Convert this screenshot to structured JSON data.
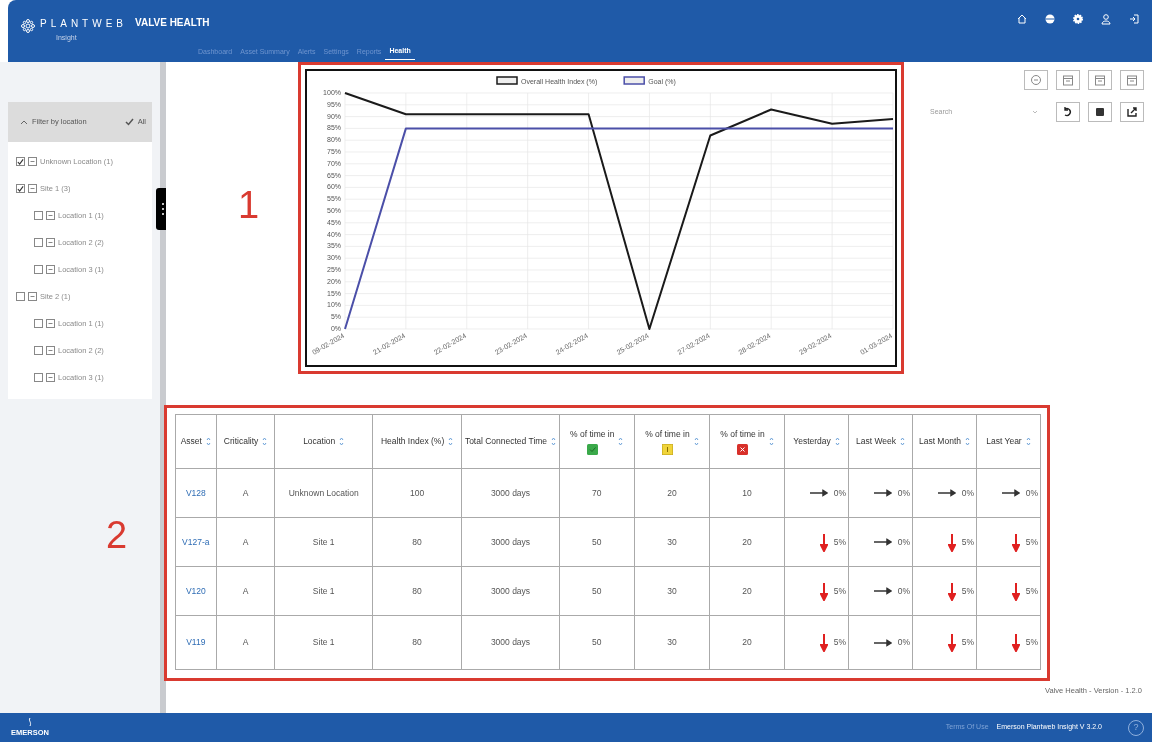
{
  "header": {
    "brand": "PLANTWEB",
    "brand_sub": "Insight",
    "app_title": "VALVE HEALTH"
  },
  "tabs": [
    {
      "label": "Dashboard",
      "selected": false
    },
    {
      "label": "Asset Summary",
      "selected": false
    },
    {
      "label": "Alerts",
      "selected": false
    },
    {
      "label": "Settings",
      "selected": false
    },
    {
      "label": "Reports",
      "selected": false
    },
    {
      "label": "Health",
      "selected": true
    }
  ],
  "filter": {
    "title": "Filter by location",
    "all_label": "All",
    "all_checked": true,
    "tree": [
      {
        "label": "Unknown Location (1)",
        "checked": true
      },
      {
        "label": "Site  1 (3)",
        "checked": true,
        "children": [
          {
            "label": "Location 1 (1)",
            "checked": false
          },
          {
            "label": "Location 2 (2)",
            "checked": false
          },
          {
            "label": "Location 3 (1)",
            "checked": false
          }
        ]
      },
      {
        "label": "Site 2 (1)",
        "checked": false,
        "children": [
          {
            "label": "Location 1 (1)",
            "checked": false
          },
          {
            "label": "Location 2 (2)",
            "checked": false
          },
          {
            "label": "Location 3 (1)",
            "checked": false
          }
        ]
      }
    ]
  },
  "annotations": [
    "1",
    "2"
  ],
  "chart": {
    "chart_data": {
      "type": "line",
      "categories": [
        "09-02-2024",
        "21-02-2024",
        "22-02-2024",
        "23-02-2024",
        "24-02-2024",
        "25-02-2024",
        "27-02-2024",
        "28-02-2024",
        "29-02-2024",
        "01-03-2024"
      ],
      "series": [
        {
          "name": "Overall Health Index (%)",
          "color": "#1a1a1a",
          "values": [
            100,
            91,
            91,
            91,
            91,
            0,
            82,
            93,
            87,
            89
          ]
        },
        {
          "name": "Goal (%)",
          "color": "#4b4fa8",
          "values": [
            0,
            85,
            85,
            85,
            85,
            85,
            85,
            85,
            85,
            85
          ]
        }
      ],
      "grid": true,
      "legend": true,
      "ylim": [
        0,
        100
      ],
      "yticks": [
        {
          "value": 0,
          "label": "0%"
        },
        {
          "value": 5,
          "label": "5%"
        },
        {
          "value": 10,
          "label": "10%"
        },
        {
          "value": 15,
          "label": "15%"
        },
        {
          "value": 20,
          "label": "20%"
        },
        {
          "value": 25,
          "label": "25%"
        },
        {
          "value": 30,
          "label": "30%"
        },
        {
          "value": 35,
          "label": "35%"
        },
        {
          "value": 40,
          "label": "40%"
        },
        {
          "value": 45,
          "label": "45%"
        },
        {
          "value": 50,
          "label": "50%"
        },
        {
          "value": 55,
          "label": "55%"
        },
        {
          "value": 60,
          "label": "60%"
        },
        {
          "value": 65,
          "label": "65%"
        },
        {
          "value": 70,
          "label": "70%"
        },
        {
          "value": 75,
          "label": "75%"
        },
        {
          "value": 80,
          "label": "80%"
        },
        {
          "value": 85,
          "label": "85%"
        },
        {
          "value": 90,
          "label": "90%"
        },
        {
          "value": 95,
          "label": "95%"
        },
        {
          "value": 100,
          "label": "100%"
        }
      ]
    }
  },
  "search": {
    "placeholder": "Search"
  },
  "table": {
    "columns": [
      {
        "label": "Asset"
      },
      {
        "label": "Criticality"
      },
      {
        "label": "Location"
      },
      {
        "label": "Health Index (%)"
      },
      {
        "label": "Total Connected Time"
      },
      {
        "label": "% of time in",
        "kind": "good"
      },
      {
        "label": "% of time in",
        "kind": "warn"
      },
      {
        "label": "% of time in",
        "kind": "bad"
      },
      {
        "label": "Yesterday"
      },
      {
        "label": "Last Week"
      },
      {
        "label": "Last Month"
      },
      {
        "label": "Last Year"
      }
    ],
    "rows": [
      {
        "asset": "V128",
        "criticality": "A",
        "location": "Unknown Location",
        "health": "100",
        "time": "3000 days",
        "good": "70",
        "warn": "20",
        "bad": "10",
        "trends": [
          {
            "kind": "flat",
            "text": "0%"
          },
          {
            "kind": "flat",
            "text": "0%"
          },
          {
            "kind": "flat",
            "text": "0%"
          },
          {
            "kind": "flat",
            "text": "0%"
          }
        ]
      },
      {
        "asset": "V127-a",
        "criticality": "A",
        "location": "Site 1",
        "health": "80",
        "time": "3000 days",
        "good": "50",
        "warn": "30",
        "bad": "20",
        "trends": [
          {
            "kind": "down",
            "text": "5%"
          },
          {
            "kind": "flat",
            "text": "0%"
          },
          {
            "kind": "down",
            "text": "5%"
          },
          {
            "kind": "down",
            "text": "5%"
          }
        ]
      },
      {
        "asset": "V120",
        "criticality": "A",
        "location": "Site 1",
        "health": "80",
        "time": "3000 days",
        "good": "50",
        "warn": "30",
        "bad": "20",
        "trends": [
          {
            "kind": "down",
            "text": "5%"
          },
          {
            "kind": "flat",
            "text": "0%"
          },
          {
            "kind": "down",
            "text": "5%"
          },
          {
            "kind": "down",
            "text": "5%"
          }
        ]
      },
      {
        "asset": "V119",
        "criticality": "A",
        "location": "Site 1",
        "health": "80",
        "time": "3000 days",
        "good": "50",
        "warn": "30",
        "bad": "20",
        "trends": [
          {
            "kind": "down",
            "text": "5%"
          },
          {
            "kind": "flat",
            "text": "0%"
          },
          {
            "kind": "down",
            "text": "5%"
          },
          {
            "kind": "down",
            "text": "5%"
          }
        ]
      }
    ]
  },
  "version": "Valve Health - Version - 1.2.0",
  "footer": {
    "logo": "EMERSON",
    "terms": "Terms Of Use",
    "product": "Emerson Plantweb Insight V 3.2.0",
    "help": "?"
  }
}
